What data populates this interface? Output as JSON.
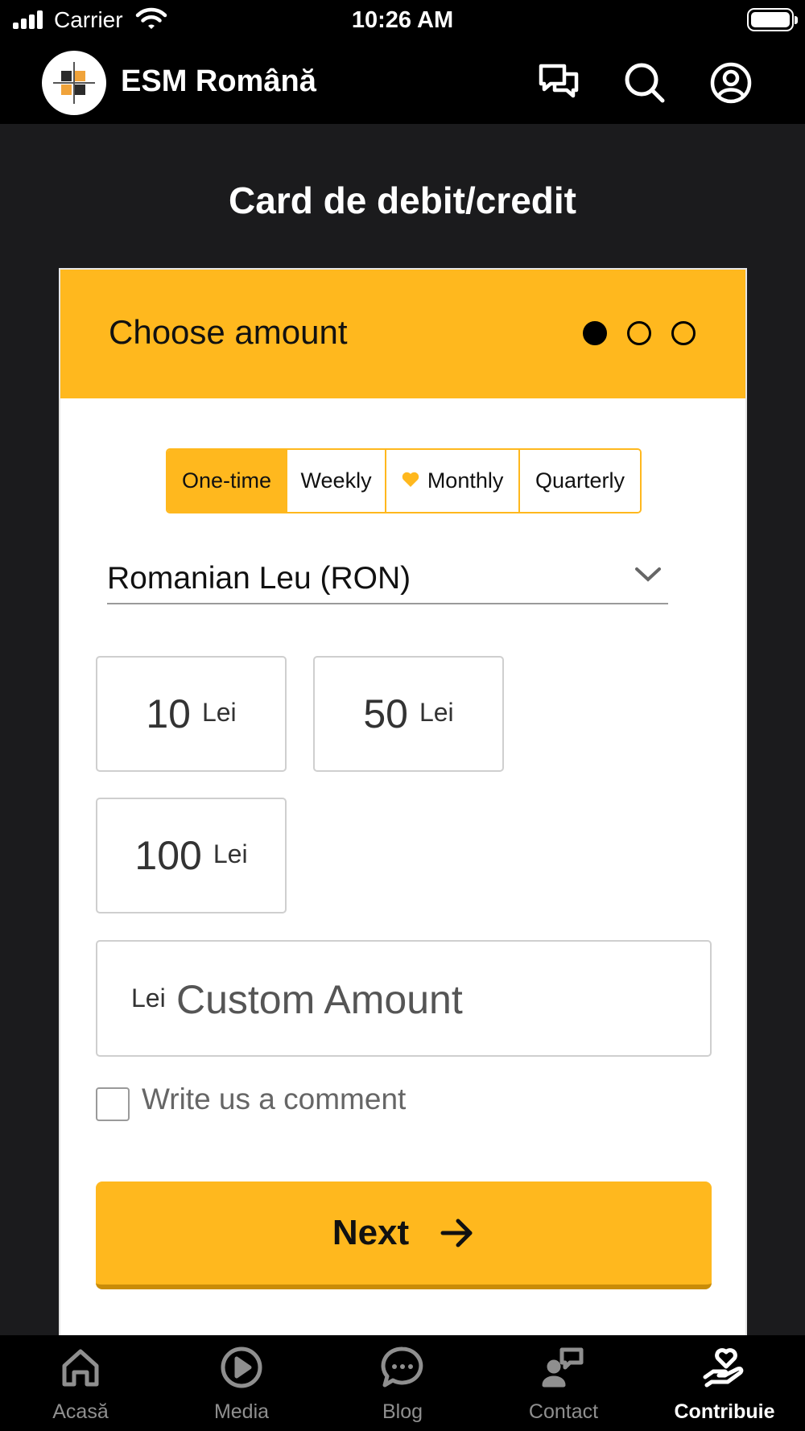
{
  "status_bar": {
    "carrier": "Carrier",
    "time": "10:26 AM",
    "signal_icon": "cellular-signal-icon",
    "wifi_icon": "wifi-icon",
    "battery_icon": "battery-icon"
  },
  "header": {
    "logo_icon": "esm-logo-icon",
    "title": "ESM Română",
    "icons": [
      "chat-icon",
      "search-icon",
      "account-icon"
    ]
  },
  "page": {
    "title": "Card de debit/credit"
  },
  "card": {
    "header_title": "Choose amount",
    "steps": {
      "total": 3,
      "current": 1
    },
    "frequency": {
      "options": [
        {
          "label": "One-time",
          "active": true
        },
        {
          "label": "Weekly",
          "active": false
        },
        {
          "label": "Monthly",
          "active": false,
          "icon": "heart-icon"
        },
        {
          "label": "Quarterly",
          "active": false
        }
      ]
    },
    "currency": {
      "selected": "Romanian Leu (RON)",
      "icon": "chevron-down-icon"
    },
    "amounts": [
      {
        "value": "10",
        "unit": "Lei"
      },
      {
        "value": "50",
        "unit": "Lei"
      },
      {
        "value": "100",
        "unit": "Lei"
      }
    ],
    "custom_amount": {
      "unit": "Lei",
      "placeholder": "Custom Amount",
      "value": ""
    },
    "comment": {
      "label": "Write us a comment",
      "checked": false
    },
    "next_button": {
      "label": "Next",
      "icon": "arrow-right-icon"
    }
  },
  "tab_bar": {
    "tabs": [
      {
        "label": "Acasă",
        "icon": "home-icon",
        "active": false
      },
      {
        "label": "Media",
        "icon": "play-icon",
        "active": false
      },
      {
        "label": "Blog",
        "icon": "chat-bubble-icon",
        "active": false
      },
      {
        "label": "Contact",
        "icon": "contact-icon",
        "active": false
      },
      {
        "label": "Contribuie",
        "icon": "donate-heart-hand-icon",
        "active": true
      }
    ]
  },
  "colors": {
    "accent": "#ffb81e",
    "background": "#1b1b1d",
    "bar": "#000000",
    "tab_inactive": "#8f8f8f"
  }
}
